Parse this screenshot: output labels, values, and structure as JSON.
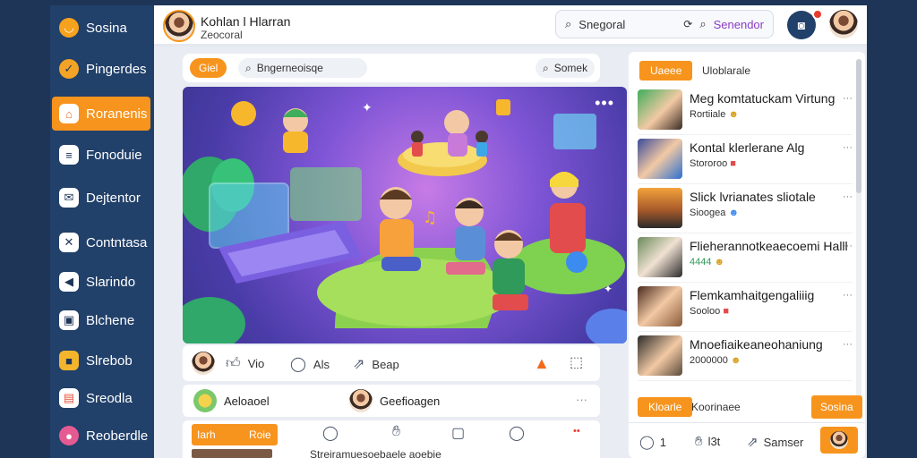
{
  "brand": {
    "name": "Sosina",
    "icon": "smile-logo-icon"
  },
  "sidebar": {
    "items": [
      {
        "label": "Pingerdes",
        "icon": "check-icon"
      },
      {
        "label": "Roranenis",
        "icon": "inbox-icon",
        "active": true
      },
      {
        "label": "Fonoduie",
        "icon": "document-icon"
      },
      {
        "label": "Dejtentor",
        "icon": "mail-icon"
      },
      {
        "label": "Contntasa",
        "icon": "tools-icon"
      },
      {
        "label": "Slarindo",
        "icon": "megaphone-icon"
      },
      {
        "label": "Blchene",
        "icon": "media-icon"
      },
      {
        "label": "Slrebob",
        "icon": "box-icon"
      },
      {
        "label": "Sreodla",
        "icon": "store-icon"
      },
      {
        "label": "Reoberdle",
        "icon": "users-icon"
      }
    ]
  },
  "header": {
    "profile_name": "Kohlan l Hlarran",
    "profile_sub": "Zeocoral",
    "search_label": "Snegoral",
    "advanced_label": "Senendor"
  },
  "composer": {
    "pill_label": "Giel",
    "input_text": "Bngerneoisqe",
    "search_label": "Somek"
  },
  "post_actions": {
    "like_label": "Vio",
    "comment_label": "Als",
    "share_label": "Beap"
  },
  "people": {
    "first": "Aeloaoel",
    "second": "Geefioagen"
  },
  "feed_bar": {
    "tab_left": "Iarh",
    "tab_right": "Roie",
    "caption": "Strejramuesoebaele aoebie"
  },
  "panel": {
    "header_pill": "Uaeee",
    "header_text": "Uloblarale",
    "items": [
      {
        "title": "Meg komtatuckam Virtung",
        "sub": "Rortiiale"
      },
      {
        "title": "Kontal klerlerane Alg",
        "sub": "Stororoo"
      },
      {
        "title": "Slick lvrianates sliotale",
        "sub": "Sioogea"
      },
      {
        "title": "Flieherannotkeaecoemi Halll",
        "sub": "4444"
      },
      {
        "title": "Flemkamhaitgengaliiig",
        "sub": "Sooloo"
      },
      {
        "title": "Mnoefiaikeaneohaniung",
        "sub": "2000000"
      }
    ],
    "footer_pill": "Kloarle",
    "footer_text": "Koorinaee",
    "footer_button": "Sosina",
    "bottom": {
      "comment_count": "1",
      "react_label": "l3t",
      "share_label": "Samser"
    }
  },
  "colors": {
    "accent": "#f7941d",
    "sidebar": "#21406a",
    "background": "#1e3558",
    "surface": "#ffffff"
  }
}
